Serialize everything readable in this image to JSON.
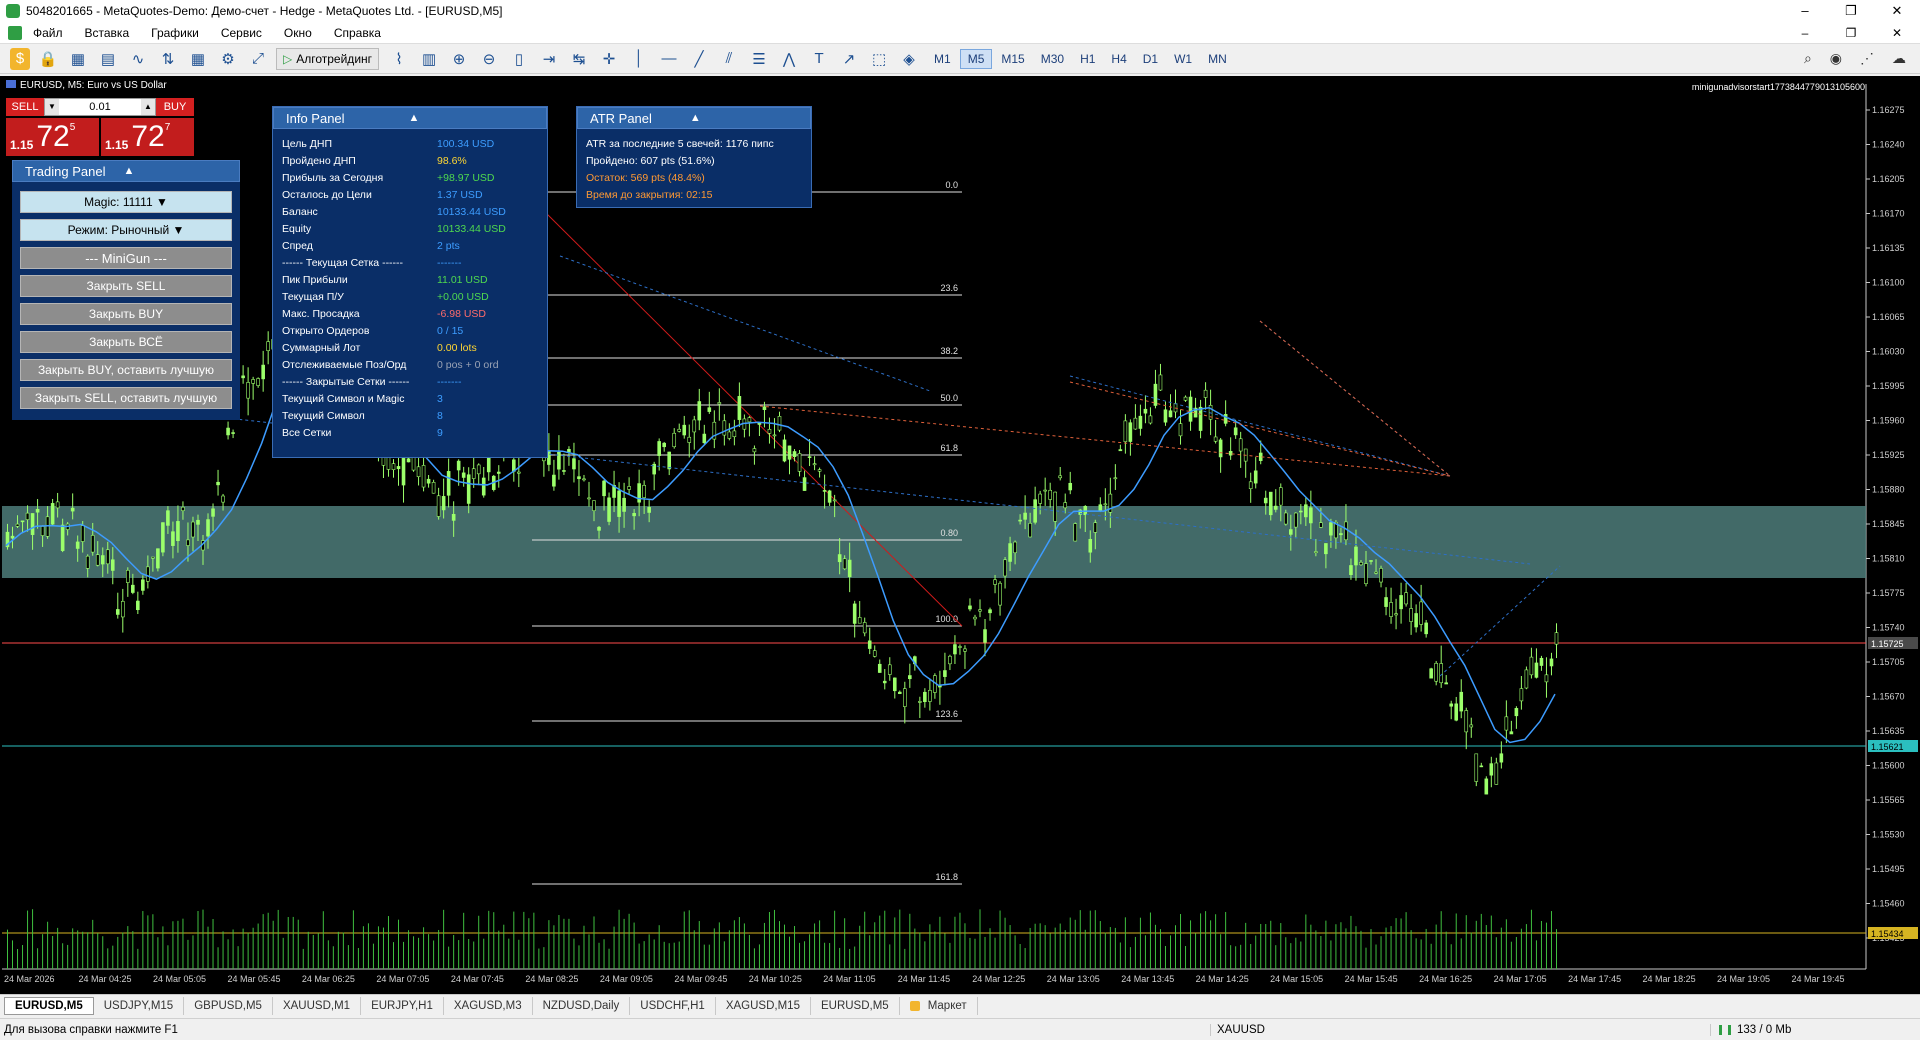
{
  "window": {
    "title": "5048201665 - MetaQuotes-Demo: Демо-счет - Hedge - MetaQuotes Ltd. - [EURUSD,M5]",
    "minimize": "–",
    "restore": "❐",
    "close": "✕"
  },
  "menu": [
    "Файл",
    "Вставка",
    "Графики",
    "Сервис",
    "Окно",
    "Справка"
  ],
  "mdi_controls": [
    "–",
    "❐",
    "✕"
  ],
  "toolbar": {
    "algo_label": "Алготрейдинг",
    "timeframes": [
      "M1",
      "M5",
      "M15",
      "M30",
      "H1",
      "H4",
      "D1",
      "W1",
      "MN"
    ],
    "active_timeframe": "M5"
  },
  "chart": {
    "header": "EURUSD, M5:  Euro vs US Dollar",
    "ea_label": "minigunadvisorstart1773844779013105600",
    "background": "#000000",
    "candle_color": "#9cff6b",
    "ma_color": "#3d9cff",
    "zone_color": "#4d7c7a",
    "y_axis_ticks": [
      "1.16275",
      "1.16240",
      "1.16205",
      "1.16170",
      "1.16135",
      "1.16100",
      "1.16065",
      "1.16030",
      "1.15995",
      "1.15960",
      "1.15925",
      "1.15880",
      "1.15845",
      "1.15810",
      "1.15775",
      "1.15740",
      "1.15705",
      "1.15670",
      "1.15635",
      "1.15600",
      "1.15565",
      "1.15530",
      "1.15495",
      "1.15460",
      "1.15425"
    ],
    "price_labels": [
      {
        "text": "1.15725",
        "color": "#1e1e1e"
      },
      {
        "text": "1.15621",
        "color": "#2bbfbf"
      },
      {
        "text": "1.15434",
        "color": "#d6b422"
      }
    ],
    "x_axis_ticks": [
      "24 Mar 2026",
      "24 Mar 04:25",
      "24 Mar 05:05",
      "24 Mar 05:45",
      "24 Mar 06:25",
      "24 Mar 07:05",
      "24 Mar 07:45",
      "24 Mar 08:25",
      "24 Mar 09:05",
      "24 Mar 09:45",
      "24 Mar 10:25",
      "24 Mar 11:05",
      "24 Mar 11:45",
      "24 Mar 12:25",
      "24 Mar 13:05",
      "24 Mar 13:45",
      "24 Mar 14:25",
      "24 Mar 15:05",
      "24 Mar 15:45",
      "24 Mar 16:25",
      "24 Mar 17:05",
      "24 Mar 17:45",
      "24 Mar 18:25",
      "24 Mar 19:05",
      "24 Mar 19:45"
    ],
    "fib_levels": [
      "0.0",
      "23.6",
      "38.2",
      "50.0",
      "61.8",
      "0.80",
      "100.0",
      "123.6",
      "161.8"
    ]
  },
  "one_click": {
    "sell_label": "SELL",
    "buy_label": "BUY",
    "lot": "0.01",
    "sell_small": "1.15",
    "sell_big": "72",
    "sell_sup": "5",
    "buy_small": "1.15",
    "buy_big": "72",
    "buy_sup": "7"
  },
  "trading_panel": {
    "title": "Trading Panel",
    "buttons": [
      "Magic: 11111 ▼",
      "Режим: Рыночный ▼",
      "--- MiniGun ---",
      "Закрыть SELL",
      "Закрыть BUY",
      "Закрыть ВСЁ",
      "Закрыть BUY, оставить лучшую",
      "Закрыть SELL, оставить лучшую"
    ]
  },
  "info_panel": {
    "title": "Info Panel",
    "rows": [
      {
        "k": "Цель ДНП",
        "v": "100.34 USD",
        "c": "#3d9dff"
      },
      {
        "k": "Пройдено ДНП",
        "v": "98.6%",
        "c": "#ffd633"
      },
      {
        "k": "Прибыль за Сегодня",
        "v": "+98.97 USD",
        "c": "#4fd94f"
      },
      {
        "k": "Осталось до Цели",
        "v": "1.37 USD",
        "c": "#3d9dff"
      },
      {
        "k": "Баланс",
        "v": "10133.44 USD",
        "c": "#3d9dff"
      },
      {
        "k": "Equity",
        "v": "10133.44 USD",
        "c": "#4fd94f"
      },
      {
        "k": "Спред",
        "v": "2 pts",
        "c": "#3d9dff"
      },
      {
        "k": "------ Текущая Сетка ------",
        "v": "-------",
        "c": "#3d9dff"
      },
      {
        "k": "Пик Прибыли",
        "v": "11.01 USD",
        "c": "#4fd94f"
      },
      {
        "k": "Текущая П/У",
        "v": "+0.00 USD",
        "c": "#4fd94f"
      },
      {
        "k": "Макс. Просадка",
        "v": "-6.98 USD",
        "c": "#ff6b6b"
      },
      {
        "k": "Открыто Ордеров",
        "v": "0 / 15",
        "c": "#3d9dff"
      },
      {
        "k": "Суммарный Лот",
        "v": "0.00 lots",
        "c": "#ffd633"
      },
      {
        "k": "Отслеживаемые Поз/Орд",
        "v": "0 pos + 0 ord",
        "c": "#9aa3b5"
      },
      {
        "k": "------ Закрытые Сетки ------",
        "v": "-------",
        "c": "#3d9dff"
      },
      {
        "k": "Текущий Символ и Magic",
        "v": "3",
        "c": "#3d9dff"
      },
      {
        "k": "Текущий Символ",
        "v": "8",
        "c": "#3d9dff"
      },
      {
        "k": "Все Сетки",
        "v": "9",
        "c": "#3d9dff"
      }
    ]
  },
  "atr_panel": {
    "title": "ATR Panel",
    "rows": [
      {
        "t": "ATR за последние 5 свечей: 1176 пипс",
        "c": "#ffffff"
      },
      {
        "t": "Пройдено:  607 pts (51.6%)",
        "c": "#ffffff"
      },
      {
        "t": "Остаток: 569 pts (48.4%)",
        "c": "#ff9933"
      },
      {
        "t": "Время до закрытия: 02:15",
        "c": "#ff9933"
      }
    ]
  },
  "chart_tabs": [
    "EURUSD,M5",
    "USDJPY,M15",
    "GBPUSD,M5",
    "XAUUSD,M1",
    "EURJPY,H1",
    "XAGUSD,M3",
    "NZDUSD,Daily",
    "USDCHF,H1",
    "XAGUSD,M15",
    "EURUSD,M5",
    "Маркет"
  ],
  "active_chart_tab": "EURUSD,M5",
  "status": {
    "help": "Для вызова справки нажмите F1",
    "symbol": "XAUUSD",
    "traffic": "133 / 0 Mb"
  }
}
